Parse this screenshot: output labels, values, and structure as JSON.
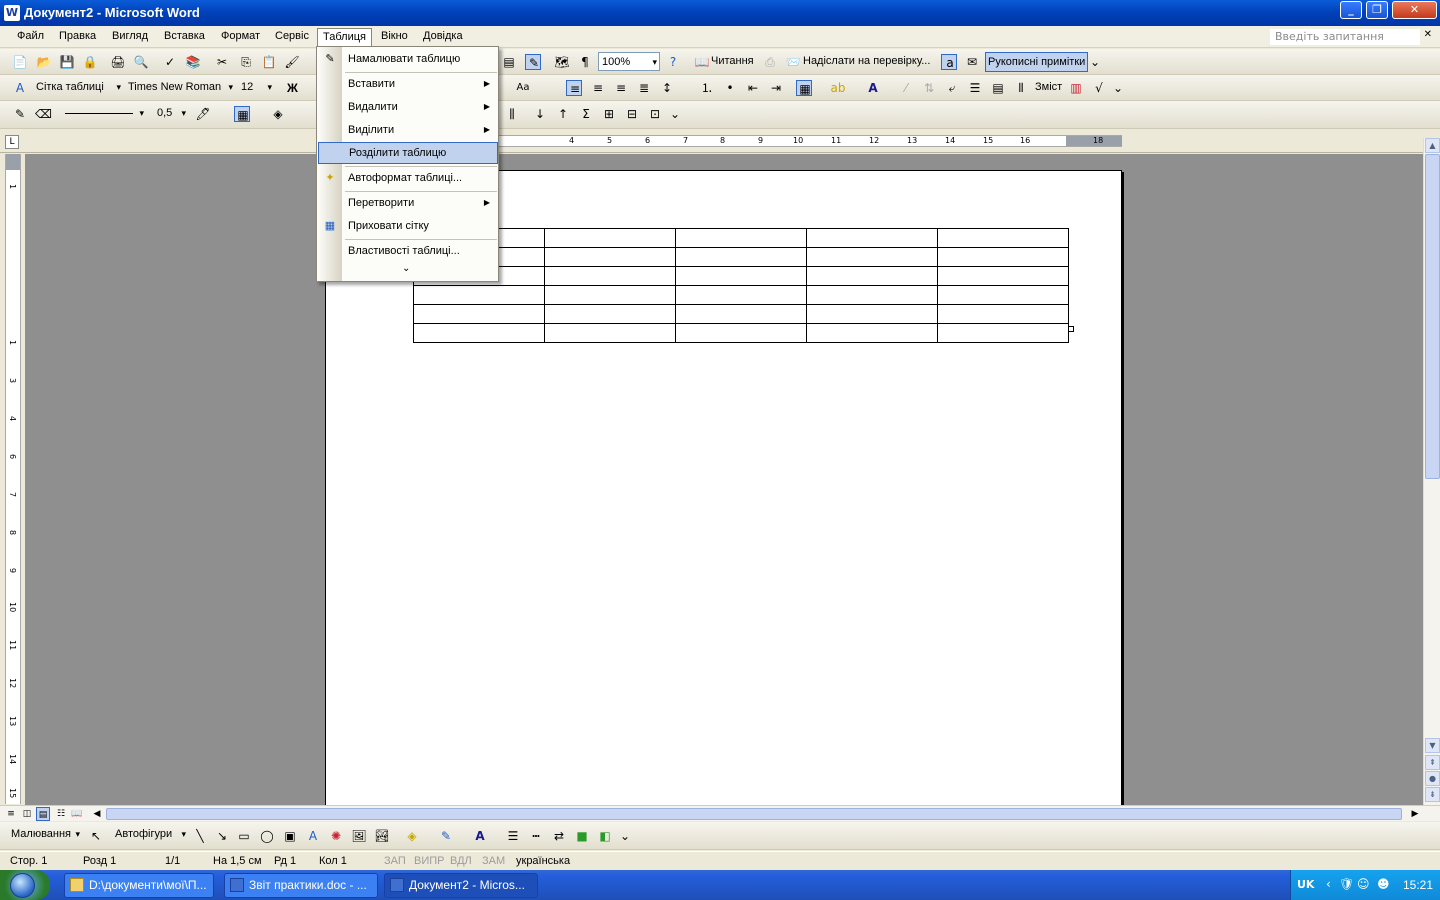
{
  "window": {
    "title": "Документ2 - Microsoft Word",
    "app_icon": "W"
  },
  "menubar": {
    "items": [
      "Файл",
      "Правка",
      "Вигляд",
      "Вставка",
      "Формат",
      "Сервіс",
      "Таблиця",
      "Вікно",
      "Довідка"
    ],
    "active": "Таблиця",
    "ask_placeholder": "Введіть запитання"
  },
  "toolbar_standard": {
    "zoom": "100%",
    "reading_label": "Читання",
    "send_review_label": "Надіслати на перевірку...",
    "ink_comments_label": "Рукописні примітки"
  },
  "toolbar_formatting": {
    "style": "Сітка таблиці",
    "font": "Times New Roman",
    "size": "12",
    "bold_label": "Ж",
    "toc_label": "Зміст"
  },
  "toolbar_tables": {
    "line_weight": "0,5"
  },
  "ruler": {
    "ticks": [
      "4",
      "5",
      "6",
      "7",
      "8",
      "9",
      "10",
      "11",
      "12",
      "13",
      "14",
      "15",
      "16",
      "18"
    ],
    "vticks": [
      "1",
      "1",
      "2",
      "3",
      "4",
      "5",
      "6",
      "7",
      "8",
      "9",
      "10",
      "11",
      "12",
      "13",
      "14",
      "15"
    ],
    "tab_selector": "L"
  },
  "table_menu": {
    "items": [
      {
        "label": "Намалювати таблицю",
        "icon": "pencil-icon"
      },
      {
        "label": "Вставити",
        "submenu": true
      },
      {
        "label": "Видалити",
        "submenu": true
      },
      {
        "label": "Виділити",
        "submenu": true
      },
      {
        "label": "Розділити таблицю",
        "highlighted": true
      },
      {
        "label": "Автоформат таблиці...",
        "icon": "autoformat-icon"
      },
      {
        "label": "Перетворити",
        "submenu": true
      },
      {
        "label": "Приховати сітку",
        "icon": "grid-icon"
      },
      {
        "label": "Властивості таблиці..."
      }
    ],
    "expand_glyph": "⌄"
  },
  "document": {
    "table_rows": 6,
    "table_cols": 5
  },
  "drawing_toolbar": {
    "draw_label": "Малювання",
    "autoshapes_label": "Автофігури"
  },
  "statusbar": {
    "page": "Стор.  1",
    "section": "Розд  1",
    "pages": "1/1",
    "at": "На  1,5 см",
    "line": "Рд  1",
    "col": "Кол  1",
    "rec": "ЗАП",
    "trk": "ВИПР",
    "ext": "ВДЛ",
    "ovr": "ЗАМ",
    "language": "українська"
  },
  "taskbar": {
    "tasks": [
      {
        "label": "D:\\документи\\мої\\П..."
      },
      {
        "label": "Звіт практики.doc - ..."
      },
      {
        "label": "Документ2 - Micros...",
        "active": true
      }
    ],
    "lang": "UK",
    "time": "15:21"
  },
  "colors": {
    "titlebar": "#0a5bd8",
    "menu_highlight": "#c1d2ee",
    "doc_background": "#8f8f8f"
  }
}
